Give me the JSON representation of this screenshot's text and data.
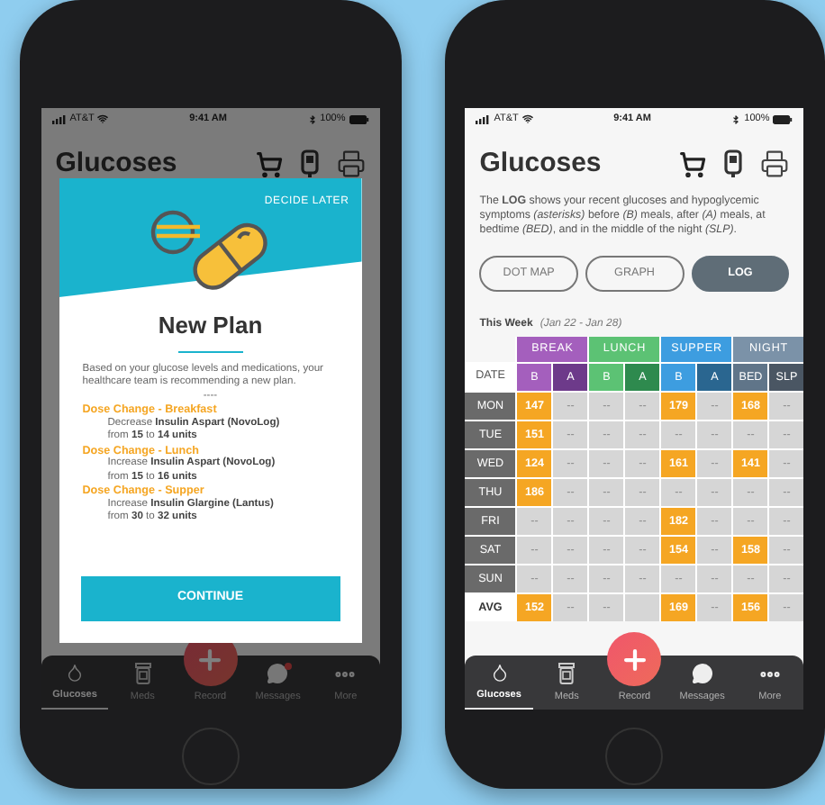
{
  "left_phone": {
    "status_bar": {
      "carrier": "AT&T",
      "time": "9:41 AM",
      "battery": "100%"
    },
    "page_title": "Glucoses",
    "modal": {
      "action": "DECIDE LATER",
      "title": "New Plan",
      "message": "Based on your glucose levels and medications, your healthcare team is recommending a new plan.",
      "separator": "----",
      "changes": [
        {
          "heading": "Dose Change - Breakfast",
          "detail": "Decrease **Insulin Aspart (NovoLog)**",
          "amount": "from **15** to **14 units**"
        },
        {
          "heading": "Dose Change - Lunch",
          "detail": "Increase **Insulin Aspart (NovoLog)**",
          "amount": "from **15** to **16 units**"
        },
        {
          "heading": "Dose Change - Supper",
          "detail": "Increase **Insulin Glargine (Lantus)**",
          "amount": "from **30** to **32 units**"
        }
      ],
      "button": "CONTINUE"
    },
    "tab_bar": [
      {
        "label": "Glucoses",
        "selected": true,
        "badge": false
      },
      {
        "label": "Meds",
        "selected": false,
        "badge": false
      },
      {
        "label": "Record",
        "selected": false,
        "badge": false
      },
      {
        "label": "Messages",
        "selected": false,
        "badge": true
      },
      {
        "label": "More",
        "selected": false,
        "badge": false
      }
    ]
  },
  "right_phone": {
    "status_bar": {
      "carrier": "AT&T",
      "time": "9:41 AM",
      "battery": "100%"
    },
    "page_title": "Glucoses",
    "intro": "The **LOG** shows your recent glucoses and hypoglycemic symptoms *(asterisks)* before *(B)* meals, after *(A)* meals, at bedtime *(BED)*, and in the middle of the night *(SLP)*.",
    "views": [
      {
        "label": "DOT MAP",
        "selected": false
      },
      {
        "label": "GRAPH",
        "selected": false
      },
      {
        "label": "LOG",
        "selected": true
      }
    ],
    "week": {
      "label": "This Week",
      "range": "(Jan 22 - Jan 28)"
    },
    "table": {
      "date_header": "DATE",
      "groups": [
        {
          "label": "BREAK",
          "color": "#a45fbd"
        },
        {
          "label": "LUNCH",
          "color": "#5cc274"
        },
        {
          "label": "SUPPER",
          "color": "#3d9de0"
        },
        {
          "label": "NIGHT",
          "color": "#7b92a8"
        }
      ],
      "columns": [
        {
          "label": "B",
          "color": "#a45fbd"
        },
        {
          "label": "A",
          "color": "#6d3a8a"
        },
        {
          "label": "B",
          "color": "#5cc274"
        },
        {
          "label": "A",
          "color": "#2e8a4e"
        },
        {
          "label": "B",
          "color": "#3d9de0"
        },
        {
          "label": "A",
          "color": "#2a6690"
        },
        {
          "label": "BED",
          "color": "#607589"
        },
        {
          "label": "SLP",
          "color": "#4a5663"
        }
      ],
      "rows": [
        {
          "day": "MON",
          "kind": "day",
          "cells": [
            {
              "text": "147",
              "high": true
            },
            {
              "text": "--",
              "high": false
            },
            {
              "text": "--",
              "high": false
            },
            {
              "text": "--",
              "high": false
            },
            {
              "text": "179",
              "high": true
            },
            {
              "text": "--",
              "high": false
            },
            {
              "text": "168",
              "high": true
            },
            {
              "text": "--",
              "high": false
            }
          ]
        },
        {
          "day": "TUE",
          "kind": "day",
          "cells": [
            {
              "text": "151",
              "high": true
            },
            {
              "text": "--",
              "high": false
            },
            {
              "text": "--",
              "high": false
            },
            {
              "text": "--",
              "high": false
            },
            {
              "text": "--",
              "high": false
            },
            {
              "text": "--",
              "high": false
            },
            {
              "text": "--",
              "high": false
            },
            {
              "text": "--",
              "high": false
            }
          ]
        },
        {
          "day": "WED",
          "kind": "day",
          "cells": [
            {
              "text": "124",
              "high": true
            },
            {
              "text": "--",
              "high": false
            },
            {
              "text": "--",
              "high": false
            },
            {
              "text": "--",
              "high": false
            },
            {
              "text": "161",
              "high": true
            },
            {
              "text": "--",
              "high": false
            },
            {
              "text": "141",
              "high": true
            },
            {
              "text": "--",
              "high": false
            }
          ]
        },
        {
          "day": "THU",
          "kind": "day",
          "cells": [
            {
              "text": "186",
              "high": true
            },
            {
              "text": "--",
              "high": false
            },
            {
              "text": "--",
              "high": false
            },
            {
              "text": "--",
              "high": false
            },
            {
              "text": "--",
              "high": false
            },
            {
              "text": "--",
              "high": false
            },
            {
              "text": "--",
              "high": false
            },
            {
              "text": "--",
              "high": false
            }
          ]
        },
        {
          "day": "FRI",
          "kind": "day",
          "cells": [
            {
              "text": "--",
              "high": false
            },
            {
              "text": "--",
              "high": false
            },
            {
              "text": "--",
              "high": false
            },
            {
              "text": "--",
              "high": false
            },
            {
              "text": "182",
              "high": true
            },
            {
              "text": "--",
              "high": false
            },
            {
              "text": "--",
              "high": false
            },
            {
              "text": "--",
              "high": false
            }
          ]
        },
        {
          "day": "SAT",
          "kind": "day",
          "cells": [
            {
              "text": "--",
              "high": false
            },
            {
              "text": "--",
              "high": false
            },
            {
              "text": "--",
              "high": false
            },
            {
              "text": "--",
              "high": false
            },
            {
              "text": "154",
              "high": true
            },
            {
              "text": "--",
              "high": false
            },
            {
              "text": "158",
              "high": true
            },
            {
              "text": "--",
              "high": false
            }
          ]
        },
        {
          "day": "SUN",
          "kind": "day",
          "cells": [
            {
              "text": "--",
              "high": false
            },
            {
              "text": "--",
              "high": false
            },
            {
              "text": "--",
              "high": false
            },
            {
              "text": "--",
              "high": false
            },
            {
              "text": "--",
              "high": false
            },
            {
              "text": "--",
              "high": false
            },
            {
              "text": "--",
              "high": false
            },
            {
              "text": "--",
              "high": false
            }
          ]
        },
        {
          "day": "AVG",
          "kind": "average",
          "cells": [
            {
              "text": "152",
              "high": true
            },
            {
              "text": "--",
              "high": false
            },
            {
              "text": "--",
              "high": false
            },
            null,
            {
              "text": "169",
              "high": true
            },
            {
              "text": "--",
              "high": false
            },
            {
              "text": "156",
              "high": true
            },
            {
              "text": "--",
              "high": false
            }
          ]
        }
      ]
    },
    "tab_bar": [
      {
        "label": "Glucoses",
        "selected": true,
        "badge": false
      },
      {
        "label": "Meds",
        "selected": false,
        "badge": false
      },
      {
        "label": "Record",
        "selected": false,
        "badge": false
      },
      {
        "label": "Messages",
        "selected": false,
        "badge": false
      },
      {
        "label": "More",
        "selected": false,
        "badge": false
      }
    ]
  }
}
